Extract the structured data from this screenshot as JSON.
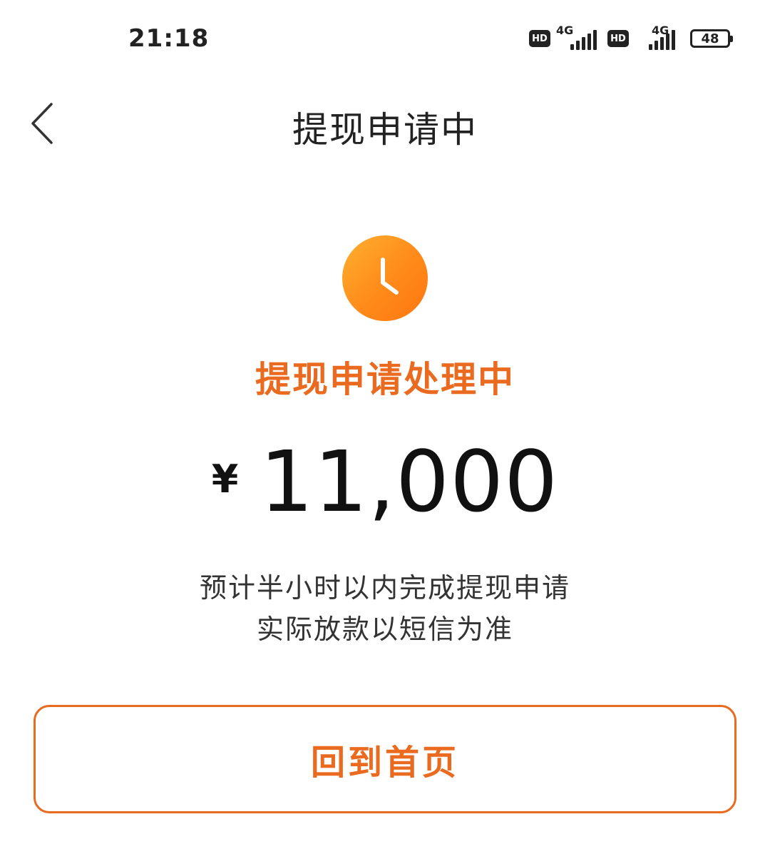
{
  "status_bar": {
    "time": "21:18",
    "sim1": {
      "hd": "HD",
      "network": "4G"
    },
    "sim2": {
      "hd": "HD",
      "network": "4G"
    },
    "battery": "48"
  },
  "nav": {
    "back_icon": "chevron-left-icon",
    "title": "提现申请中"
  },
  "status": {
    "icon": "clock-icon",
    "title": "提现申请处理中",
    "accent_color": "#ea6a1f"
  },
  "amount": {
    "currency": "¥",
    "value": "11,000"
  },
  "notices": [
    "预计半小时以内完成提现申请",
    "实际放款以短信为准"
  ],
  "actions": {
    "home_label": "回到首页"
  }
}
